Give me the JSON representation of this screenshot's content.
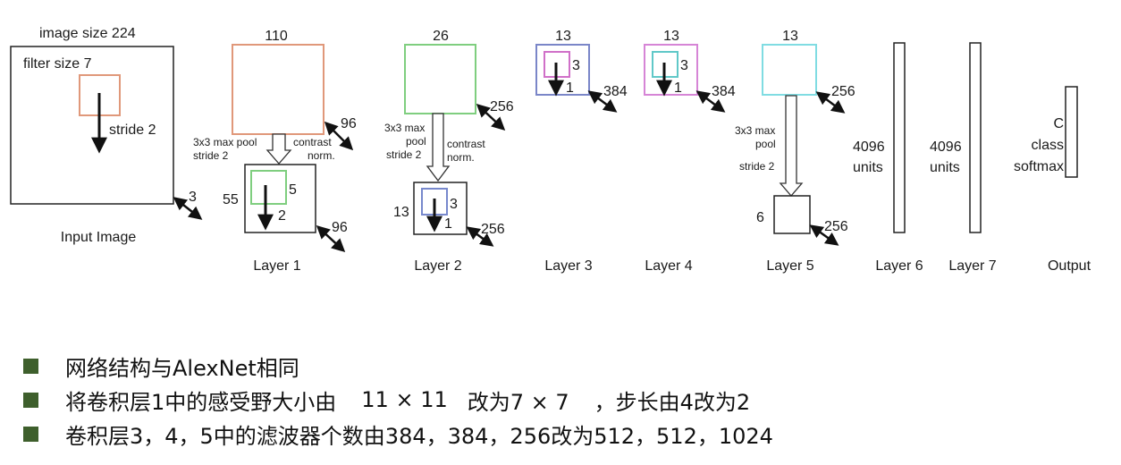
{
  "input": {
    "image_size": "image size 224",
    "filter_size": "filter size 7",
    "stride": "stride 2",
    "depth": "3",
    "caption": "Input Image"
  },
  "layer1": {
    "size": "110",
    "depth": "96",
    "pool_label": [
      "3x3 max pool",
      "stride 2"
    ],
    "norm_label": [
      "contrast",
      "norm."
    ],
    "pooled_size": "55",
    "filter": "5",
    "stride": "2",
    "pooled_depth": "96",
    "caption": "Layer 1"
  },
  "layer2": {
    "size": "26",
    "depth": "256",
    "pool_label": [
      "3x3 max",
      "pool",
      "stride 2"
    ],
    "norm_label": [
      "contrast",
      "norm."
    ],
    "pooled_size": "13",
    "filter": "3",
    "stride": "1",
    "pooled_depth": "256",
    "caption": "Layer 2"
  },
  "layer3": {
    "size": "13",
    "filter": "3",
    "stride": "1",
    "depth": "384",
    "caption": "Layer 3"
  },
  "layer4": {
    "size": "13",
    "filter": "3",
    "stride": "1",
    "depth": "384",
    "caption": "Layer 4"
  },
  "layer5": {
    "size": "13",
    "depth": "256",
    "pool_label": [
      "3x3 max",
      "pool",
      "stride 2"
    ],
    "pooled_size": "6",
    "pooled_depth": "256",
    "caption": "Layer 5"
  },
  "layer6": {
    "units": [
      "4096",
      "units"
    ],
    "caption": "Layer 6"
  },
  "layer7": {
    "units": [
      "4096",
      "units"
    ],
    "caption": "Layer 7"
  },
  "output": {
    "units": [
      "C",
      "class",
      "softmax"
    ],
    "caption": "Output"
  },
  "colors": {
    "layer1": "#e0987a",
    "layer2": "#7fce7f",
    "layer2_inner": "#7788cc",
    "layer3_outer": "#7a86c8",
    "layer3_inner": "#d070c8",
    "layer4_outer": "#d685d6",
    "layer4_inner": "#60c8c8",
    "layer5": "#80dce2",
    "bullet": "#3e5f2c"
  },
  "bullets": {
    "b1": "网络结构与AlexNet相同",
    "b2_a": "将卷积层1中的感受野大小由",
    "b2_b": "11 × 11",
    "b2_c": "改为7 × 7",
    "b2_d": "，步长由4改为2",
    "b3": "卷积层3，4，5中的滤波器个数由384，384，256改为512，512，1024"
  }
}
